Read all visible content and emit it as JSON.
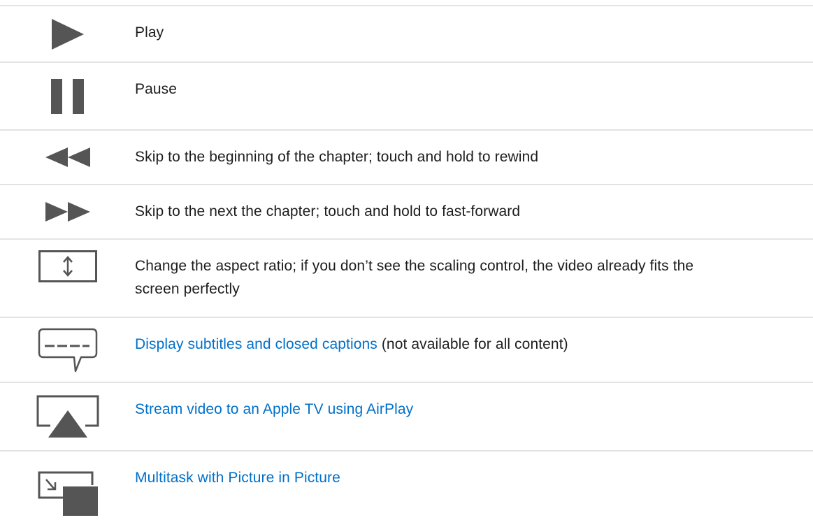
{
  "rows": [
    {
      "icon": "play-icon",
      "text": "Play"
    },
    {
      "icon": "pause-icon",
      "text": "Pause"
    },
    {
      "icon": "rewind-icon",
      "text": "Skip to the beginning of the chapter; touch and hold to rewind"
    },
    {
      "icon": "fast-forward-icon",
      "text": "Skip to the next the chapter; touch and hold to fast-forward"
    },
    {
      "icon": "aspect-ratio-icon",
      "text": "Change the aspect ratio; if you don’t see the scaling control, the video already fits the screen perfectly"
    },
    {
      "icon": "subtitles-icon",
      "link": "Display subtitles and closed captions",
      "text": " (not available for all content)"
    },
    {
      "icon": "airplay-icon",
      "link": "Stream video to an Apple TV using AirPlay"
    },
    {
      "icon": "picture-in-picture-icon",
      "link": "Multitask with Picture in Picture"
    }
  ],
  "colors": {
    "icon": "#555555",
    "link": "#0070c9",
    "divider": "#e3e3e3",
    "text": "#1d1d1f"
  }
}
